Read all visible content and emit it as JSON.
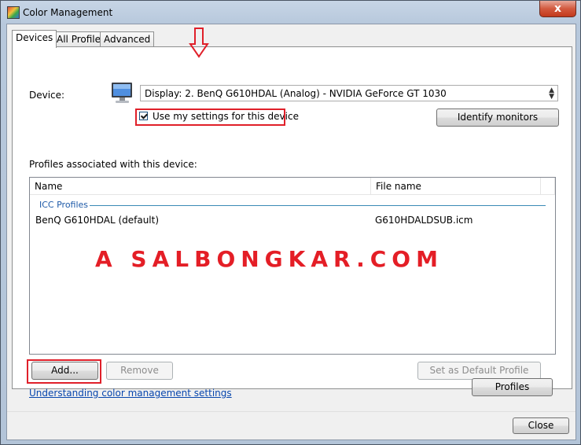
{
  "window": {
    "title": "Color Management",
    "close_glyph": "x"
  },
  "tabs": [
    {
      "label": "Devices",
      "active": true
    },
    {
      "label": "All Profiles",
      "active": false
    },
    {
      "label": "Advanced",
      "active": false
    }
  ],
  "device": {
    "label": "Device:",
    "selected": "Display: 2. BenQ G610HDAL (Analog) - NVIDIA GeForce GT 1030",
    "use_my_settings_label": "Use my settings for this device",
    "use_my_settings_checked": true,
    "identify_button": "Identify monitors"
  },
  "profiles": {
    "section_label": "Profiles associated with this device:",
    "columns": [
      "Name",
      "File name"
    ],
    "group": "ICC Profiles",
    "rows": [
      {
        "name": "BenQ G610HDAL (default)",
        "file": "G610HDALDSUB.icm"
      }
    ]
  },
  "actions": {
    "add": "Add...",
    "remove": "Remove",
    "set_default": "Set as Default Profile"
  },
  "footer": {
    "link": "Understanding color management settings",
    "profiles_button": "Profiles",
    "close_button": "Close"
  },
  "watermark": "A SALBONGKAR.COM",
  "colors": {
    "highlight_red": "#e0202a",
    "link_blue": "#0645ad"
  }
}
